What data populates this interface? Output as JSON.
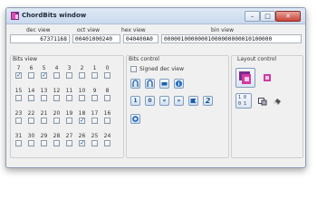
{
  "window": {
    "title": "ChordBits window"
  },
  "controls": {
    "minimize": "–",
    "maximize": "□",
    "close": "✕"
  },
  "views": {
    "dec": {
      "label": "dec view",
      "value": "67371168"
    },
    "oct": {
      "label": "oct view",
      "value": "00401000240"
    },
    "hex": {
      "label": "hex view",
      "value": "040400A0"
    },
    "bin": {
      "label": "bin view",
      "value": "00000100000001000000000010100000"
    }
  },
  "bits_view": {
    "label": "Bits view",
    "rows": [
      {
        "labels": [
          "7",
          "6",
          "5",
          "4",
          "3",
          "2",
          "1",
          "0"
        ],
        "checked": [
          true,
          false,
          true,
          false,
          false,
          false,
          false,
          false
        ]
      },
      {
        "labels": [
          "15",
          "14",
          "13",
          "12",
          "11",
          "10",
          "9",
          "8"
        ],
        "checked": [
          false,
          false,
          false,
          false,
          false,
          false,
          false,
          false
        ]
      },
      {
        "labels": [
          "23",
          "22",
          "21",
          "20",
          "19",
          "18",
          "17",
          "16"
        ],
        "checked": [
          false,
          false,
          false,
          false,
          false,
          true,
          false,
          false
        ]
      },
      {
        "labels": [
          "31",
          "30",
          "29",
          "28",
          "27",
          "26",
          "25",
          "24"
        ],
        "checked": [
          false,
          false,
          false,
          false,
          false,
          true,
          false,
          false
        ]
      }
    ]
  },
  "bits_control": {
    "label": "Bits control",
    "signed_label": "Signed dec view",
    "signed_checked": false,
    "buttons_row2": [
      "1",
      "0",
      "«",
      "»",
      "",
      "2"
    ]
  },
  "layout_control": {
    "label": "Layout control",
    "small_labels": [
      "1 0",
      "0 1"
    ]
  },
  "colors": {
    "accent": "#1e5fa8",
    "app_icon": "#c02a8c"
  }
}
